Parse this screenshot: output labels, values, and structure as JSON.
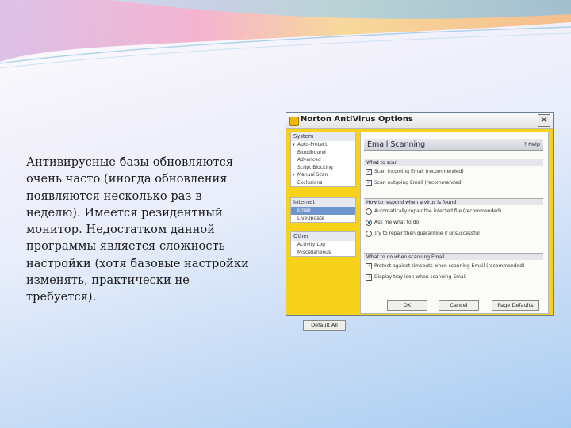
{
  "slide": {
    "paragraph": "Антивирусные базы обновляются очень часто (иногда обновления появляются несколько раз в неделю). Имеется резидентный монитор. Недостатком данной программы является сложность настройки (хотя базовые настройки изменять, практически не требуется)."
  },
  "window": {
    "title": "Norton AntiVirus Options",
    "close_glyph": "✕",
    "left_groups": [
      {
        "header": "System",
        "items": [
          {
            "label": "Auto-Protect",
            "expander": "▾",
            "selected": false
          },
          {
            "label": "Bloodhound",
            "expander": "",
            "selected": false
          },
          {
            "label": "Advanced",
            "expander": "",
            "selected": false
          },
          {
            "label": "Script Blocking",
            "expander": "",
            "selected": false
          },
          {
            "label": "Manual Scan",
            "expander": "▸",
            "selected": false
          },
          {
            "label": "Exclusions",
            "expander": "",
            "selected": false
          }
        ]
      },
      {
        "header": "Internet",
        "items": [
          {
            "label": "Email",
            "expander": "",
            "selected": true
          },
          {
            "label": "LiveUpdate",
            "expander": "",
            "selected": false
          }
        ]
      },
      {
        "header": "Other",
        "items": [
          {
            "label": "Activity Log",
            "expander": "",
            "selected": false
          },
          {
            "label": "Miscellaneous",
            "expander": "",
            "selected": false
          }
        ]
      }
    ],
    "default_all": "Default All",
    "panel_title": "Email Scanning",
    "help": "? Help",
    "sections": [
      {
        "heading": "What to scan",
        "options": [
          {
            "kind": "checkbox",
            "checked": true,
            "label": "Scan incoming Email (recommended)"
          },
          {
            "kind": "checkbox",
            "checked": true,
            "label": "Scan outgoing Email (recommended)"
          }
        ]
      },
      {
        "heading": "How to respond when a virus is found",
        "options": [
          {
            "kind": "radio",
            "checked": false,
            "label": "Automatically repair the infected file (recommended)"
          },
          {
            "kind": "radio",
            "checked": true,
            "label": "Ask me what to do"
          },
          {
            "kind": "radio",
            "checked": false,
            "label": "Try to repair then quarantine if unsuccessful"
          }
        ]
      },
      {
        "heading": "What to do when scanning Email",
        "options": [
          {
            "kind": "checkbox",
            "checked": true,
            "label": "Protect against timeouts when scanning Email (recommended)"
          },
          {
            "kind": "checkbox",
            "checked": true,
            "label": "Display tray icon when scanning Email"
          }
        ]
      }
    ],
    "buttons": {
      "ok": "OK",
      "cancel": "Cancel",
      "page_defaults": "Page Defaults"
    },
    "check_glyph": "✓"
  }
}
